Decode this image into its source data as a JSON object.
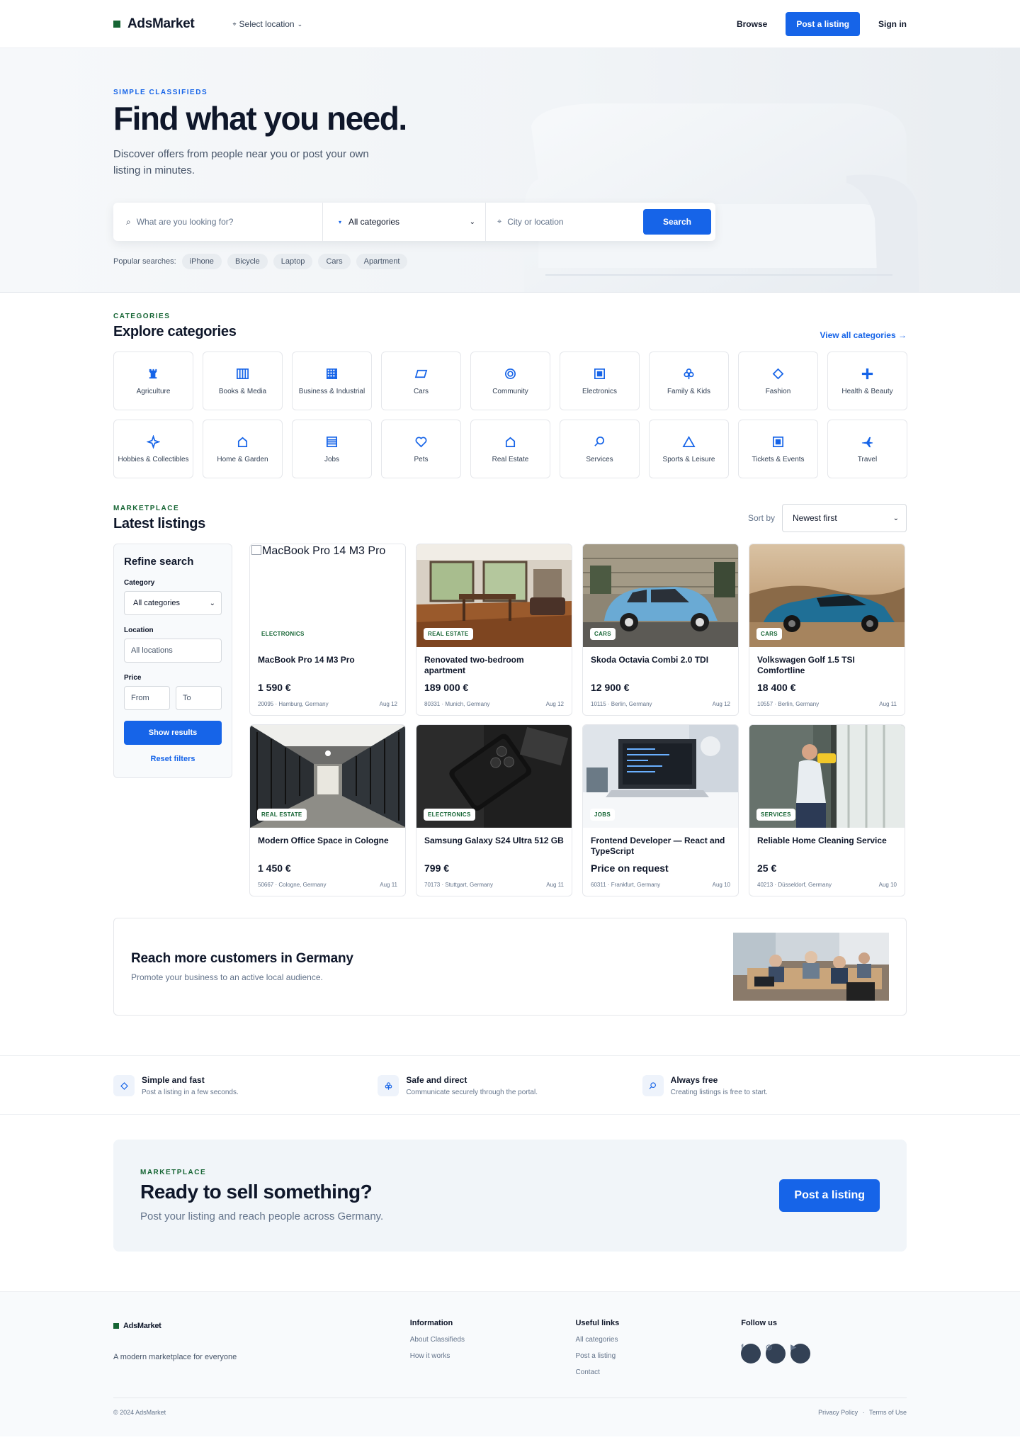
{
  "header": {
    "logo": "AdsMarket",
    "location_select": "Select location",
    "nav_browse": "Browse",
    "nav_post": "Post a listing",
    "nav_signin": "Sign in"
  },
  "hero": {
    "eyebrow": "SIMPLE CLASSIFIEDS",
    "title": "Find what you need.",
    "subtitle": "Discover offers from people near you or post your own listing in minutes.",
    "search_placeholder": "What are you looking for?",
    "category_value": "All categories",
    "city_placeholder": "City or location",
    "search_button": "Search",
    "popular_label": "Popular searches:",
    "popular": [
      "iPhone",
      "Bicycle",
      "Laptop",
      "Cars",
      "Apartment"
    ]
  },
  "categories": {
    "eyebrow": "CATEGORIES",
    "title": "Explore categories",
    "view_all": "View all categories →",
    "items": [
      {
        "label": "Agriculture",
        "icon": "chess-rook-icon"
      },
      {
        "label": "Books & Media",
        "icon": "books-icon"
      },
      {
        "label": "Business & Industrial",
        "icon": "building-grid-icon"
      },
      {
        "label": "Cars",
        "icon": "car-parallelogram-icon"
      },
      {
        "label": "Community",
        "icon": "target-circle-icon"
      },
      {
        "label": "Electronics",
        "icon": "chip-square-icon"
      },
      {
        "label": "Family & Kids",
        "icon": "club-icon"
      },
      {
        "label": "Fashion",
        "icon": "diamond-icon"
      },
      {
        "label": "Health & Beauty",
        "icon": "plus-icon"
      },
      {
        "label": "Hobbies & Collectibles",
        "icon": "sparkle-icon"
      },
      {
        "label": "Home & Garden",
        "icon": "house-icon"
      },
      {
        "label": "Jobs",
        "icon": "list-icon"
      },
      {
        "label": "Pets",
        "icon": "heart-icon"
      },
      {
        "label": "Real Estate",
        "icon": "house-icon"
      },
      {
        "label": "Services",
        "icon": "magnifier-icon"
      },
      {
        "label": "Sports & Leisure",
        "icon": "triangle-icon"
      },
      {
        "label": "Tickets & Events",
        "icon": "ticket-square-icon"
      },
      {
        "label": "Travel",
        "icon": "airplane-icon"
      }
    ]
  },
  "listings": {
    "eyebrow": "MARKETPLACE",
    "title": "Latest listings",
    "sort_label": "Sort by",
    "sort_value": "Newest first",
    "refine": {
      "title": "Refine search",
      "category_label": "Category",
      "category_value": "All categories",
      "location_label": "Location",
      "location_placeholder": "All locations",
      "price_label": "Price",
      "price_from": "From",
      "price_to": "To",
      "show_button": "Show results",
      "reset": "Reset filters"
    },
    "items": [
      {
        "img_alt": "MacBook Pro 14 M3 Pro",
        "badge": "ELECTRONICS",
        "title": "MacBook Pro 14 M3 Pro",
        "price": "1 590 €",
        "location": "20095 · Hamburg, Germany",
        "date": "Aug 12",
        "photo": "broken"
      },
      {
        "badge": "REAL ESTATE",
        "title": "Renovated two-bedroom apartment",
        "price": "189 000 €",
        "location": "80331 · Munich, Germany",
        "date": "Aug 12",
        "photo": "interior"
      },
      {
        "badge": "CARS",
        "title": "Skoda Octavia Combi 2.0 TDI",
        "price": "12 900 €",
        "location": "10115 · Berlin, Germany",
        "date": "Aug 12",
        "photo": "bluecar"
      },
      {
        "badge": "CARS",
        "title": "Volkswagen Golf 1.5 TSI Comfortline",
        "price": "18 400 €",
        "location": "10557 · Berlin, Germany",
        "date": "Aug 11",
        "photo": "sportscar"
      },
      {
        "badge": "REAL ESTATE",
        "title": "Modern Office Space in Cologne",
        "price": "1 450 €",
        "location": "50667 · Cologne, Germany",
        "date": "Aug 11",
        "photo": "office"
      },
      {
        "badge": "ELECTRONICS",
        "title": "Samsung Galaxy S24 Ultra 512 GB",
        "price": "799 €",
        "location": "70173 · Stuttgart, Germany",
        "date": "Aug 11",
        "photo": "phone"
      },
      {
        "badge": "JOBS",
        "title": "Frontend Developer — React and TypeScript",
        "price": "Price on request",
        "location": "60311 · Frankfurt, Germany",
        "date": "Aug 10",
        "photo": "laptop"
      },
      {
        "badge": "SERVICES",
        "title": "Reliable Home Cleaning Service",
        "price": "25 €",
        "location": "40213 · Düsseldorf, Germany",
        "date": "Aug 10",
        "photo": "cleaning"
      }
    ]
  },
  "promo": {
    "title": "Reach more customers in Germany",
    "subtitle": "Promote your business to an active local audience."
  },
  "features": [
    {
      "title": "Simple and fast",
      "text": "Post a listing in a few seconds.",
      "icon": "diamond-icon"
    },
    {
      "title": "Safe and direct",
      "text": "Communicate securely through the portal.",
      "icon": "club-icon"
    },
    {
      "title": "Always free",
      "text": "Creating listings is free to start.",
      "icon": "magnifier-icon"
    }
  ],
  "cta": {
    "eyebrow": "MARKETPLACE",
    "title": "Ready to sell something?",
    "subtitle": "Post your listing and reach people across Germany.",
    "button": "Post a listing"
  },
  "footer": {
    "logo": "AdsMarket",
    "tagline": "A modern marketplace for everyone",
    "info_title": "Information",
    "info_links": [
      "About Classifieds",
      "How it works"
    ],
    "useful_title": "Useful links",
    "useful_links": [
      "All categories",
      "Post a listing",
      "Contact"
    ],
    "follow_title": "Follow us",
    "socials": [
      {
        "glyph": "f",
        "icon": "facebook-icon"
      },
      {
        "glyph": "◎",
        "icon": "instagram-icon"
      },
      {
        "glyph": "▶",
        "icon": "youtube-icon"
      }
    ],
    "copyright": "© 2024 AdsMarket",
    "privacy": "Privacy Policy",
    "separator": "·",
    "terms": "Terms of Use"
  },
  "colors": {
    "accent": "#1664e8",
    "brand_green": "#166534",
    "text": "#0f172a"
  }
}
